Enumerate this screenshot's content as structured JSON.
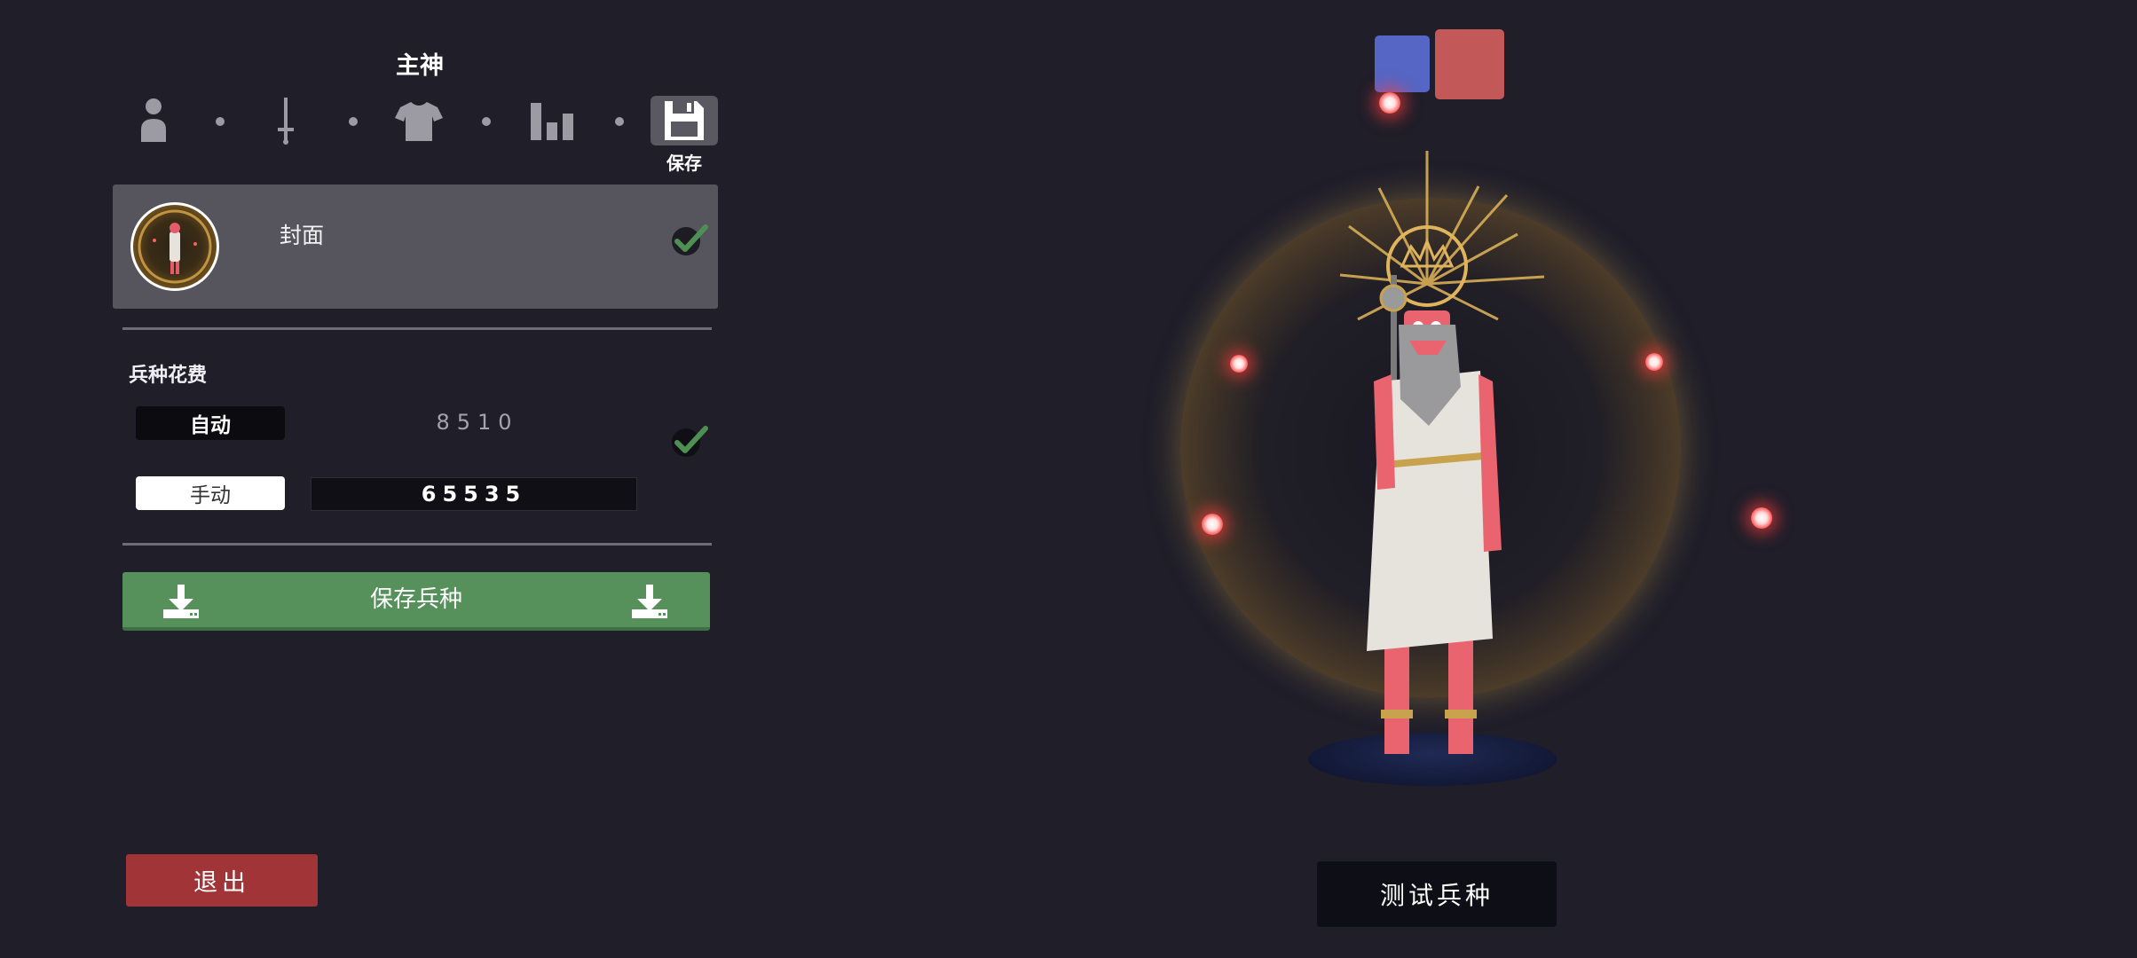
{
  "editor": {
    "unit_name": "主神",
    "steps": [
      {
        "icon": "body-icon",
        "active": false
      },
      {
        "icon": "sword-icon",
        "active": false
      },
      {
        "icon": "shirt-icon",
        "active": false
      },
      {
        "icon": "stats-icon",
        "active": false
      },
      {
        "icon": "floppy-disk-icon",
        "active": true,
        "label": "保存"
      }
    ],
    "cover": {
      "label": "封面",
      "checked": true
    },
    "cost": {
      "section_label": "兵种花费",
      "auto_label": "自动",
      "auto_value": "8510",
      "auto_checked": true,
      "manual_label": "手动",
      "manual_value": "65535"
    },
    "save_button_label": "保存兵种",
    "exit_button_label": "退出"
  },
  "preview": {
    "team_colors": {
      "blue": "#5566c4",
      "red": "#c35858"
    },
    "test_button_label": "测试兵种"
  },
  "colors": {
    "background": "#1f1e29",
    "save_green": "#56905a",
    "exit_red": "#a03436"
  }
}
